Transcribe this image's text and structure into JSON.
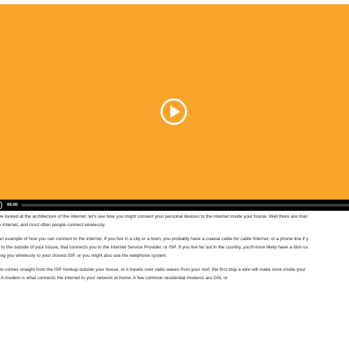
{
  "player": {
    "time": "00:00",
    "progress": 0,
    "colors": {
      "stage": "#f9a42a",
      "bar": "#000000"
    }
  },
  "transcript": {
    "lines": [
      "ve looked at the architecture of the internet, let's see how you might connect your personal devices to the internet inside your house. Well there are man",
      "e internet, and most often people connect wirelessly.",
      "an example of how you can connect to the internet. If you live in a city or a town, you probably have a coaxial cable for cable Internet, or a phone line if y",
      "g to the outside of your house, that connects you to the Internet Service Provider, or ISP. If you live far out in the country, you'll more likely have a dish ou",
      "cting you wirelessly to your closest ISP, or you might also use the telephone system.",
      "ire comes straight from the ISP hookup outside your house, or it travels over radio waves from your roof, the first stop a wire will make once inside your",
      ". A modem is what connects the internet to your network at home. A few common residential modems are DSL or"
    ]
  }
}
